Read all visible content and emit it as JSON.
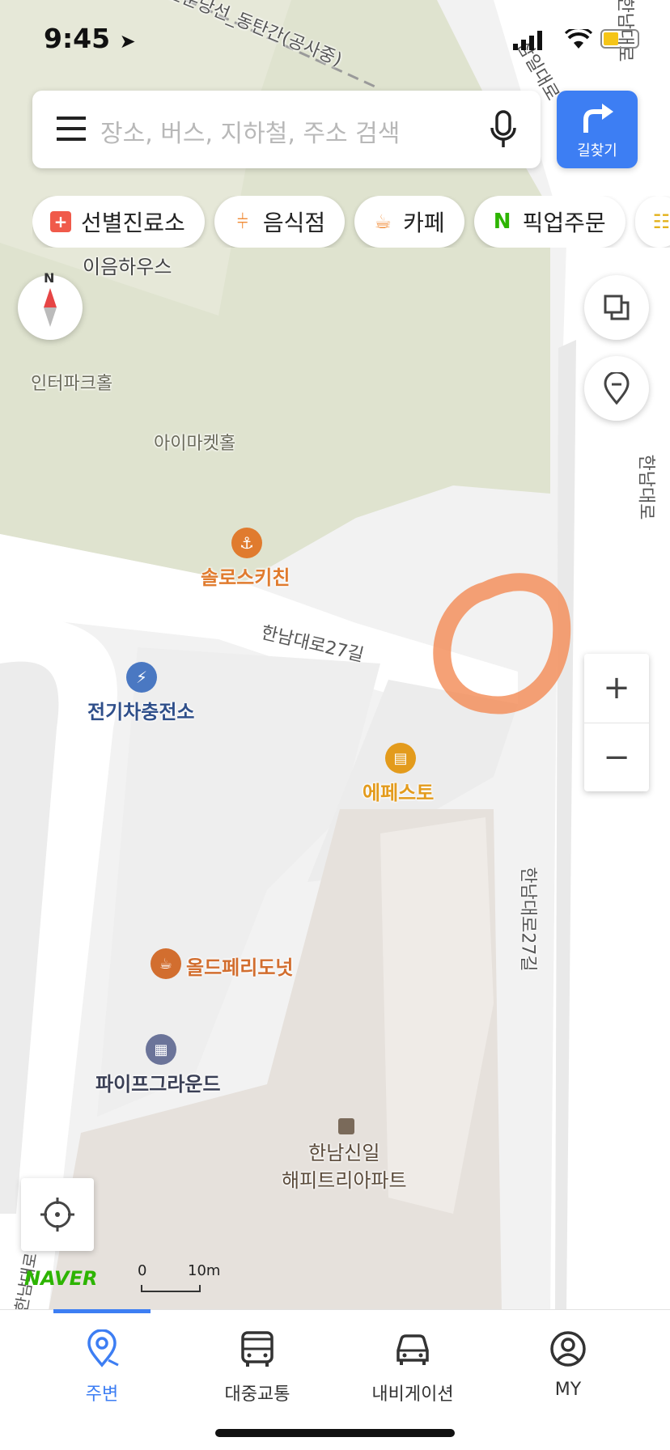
{
  "status_bar": {
    "time": "9:45"
  },
  "search": {
    "placeholder": "장소, 버스, 지하철, 주소 검색"
  },
  "directions_button": {
    "label": "길찾기"
  },
  "chips": [
    {
      "label": "선별진료소",
      "icon": "clinic-cross-icon",
      "color": "#f05a4a"
    },
    {
      "label": "음식점",
      "icon": "fork-knife-icon",
      "color": "#f08a34"
    },
    {
      "label": "카페",
      "icon": "coffee-cup-icon",
      "color": "#f08a34"
    },
    {
      "label": "픽업주문",
      "icon": "naver-n-icon",
      "color": "#2db400"
    }
  ],
  "map": {
    "pois": [
      {
        "label": "솔로스키친",
        "icon": "restaurant-icon",
        "color": "#e07b2e"
      },
      {
        "label": "전기차충전소",
        "icon": "ev-charger-icon",
        "color": "#4a78c2"
      },
      {
        "label": "에페스토",
        "icon": "shopping-bag-icon",
        "color": "#e39b1c"
      },
      {
        "label": "올드페리도넛",
        "icon": "cafe-icon",
        "color": "#d26e2f"
      },
      {
        "label": "파이프그라운드",
        "icon": "building-icon",
        "color": "#6b7499"
      },
      {
        "label": "한남신일\n해피트리아파트",
        "icon": "apartment-icon",
        "color": "#7a6a5a"
      }
    ],
    "places": [
      "이음하우스",
      "인터파크홀",
      "아이마켓홀"
    ],
    "roads": [
      "한남대로27길",
      "한남대로27길",
      "한남대로",
      "삼일대로",
      "한남대로",
      "한남대로"
    ],
    "top_label": "신분당선_동탄간(공사중)",
    "compass_label": "N"
  },
  "zoom": {
    "in": "+",
    "out": "−"
  },
  "branding": {
    "logo": "NAVER"
  },
  "scale": {
    "start": "0",
    "end": "10m"
  },
  "bottom_nav": [
    {
      "label": "주변",
      "icon": "nearby-pin-icon",
      "active": true
    },
    {
      "label": "대중교통",
      "icon": "bus-icon",
      "active": false
    },
    {
      "label": "내비게이션",
      "icon": "car-icon",
      "active": false
    },
    {
      "label": "MY",
      "icon": "user-profile-icon",
      "active": false
    }
  ],
  "colors": {
    "accent": "#3d7ef3",
    "park": "#dfe3cf",
    "annotation": "#f3905e"
  }
}
